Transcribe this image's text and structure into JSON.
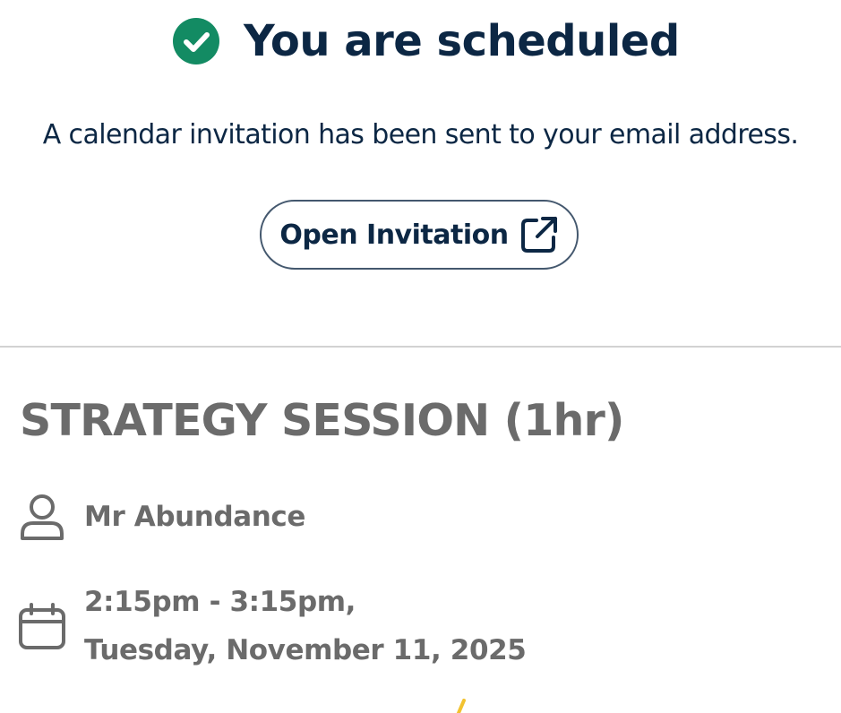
{
  "header": {
    "title": "You are scheduled",
    "subtitle": "A calendar invitation has been sent to your email address.",
    "open_invitation_label": "Open Invitation",
    "status_icon": "check-circle-icon",
    "status_color": "#138b63"
  },
  "event": {
    "title": "STRATEGY SESSION (1hr)",
    "host": "Mr Abundance",
    "time_range": "2:15pm - 3:15pm,",
    "date": "Tuesday, November 11, 2025",
    "host_icon": "person-icon",
    "date_icon": "calendar-icon"
  },
  "colors": {
    "heading": "#0c2744",
    "detail_text": "#6b6b6b",
    "accent": "#138b63",
    "divider": "#d2d2d2"
  }
}
